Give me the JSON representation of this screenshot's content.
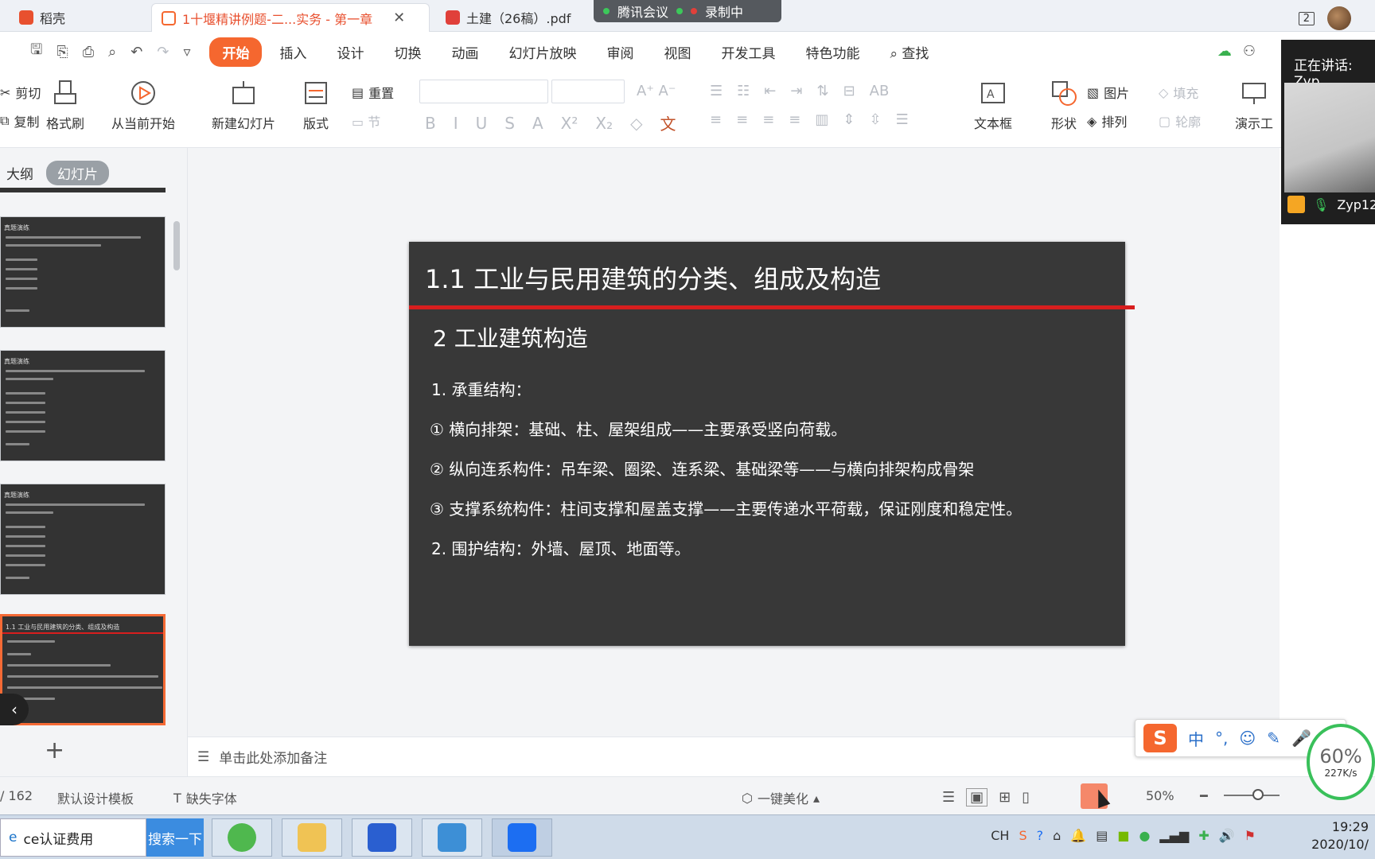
{
  "titlebar": {
    "tabs": [
      {
        "label": "稻壳",
        "color": "#e8502f"
      },
      {
        "label": "1十堰精讲例题-二...实务 - 第一章",
        "color": "#f5672f"
      },
      {
        "label": "土建（26稿）.pdf",
        "color": "#e0403a"
      }
    ],
    "meeting": {
      "name": "腾讯会议",
      "recording": "录制中"
    },
    "window_count": "2"
  },
  "menubar": {
    "items": [
      "开始",
      "插入",
      "设计",
      "切换",
      "动画",
      "幻灯片放映",
      "审阅",
      "视图",
      "开发工具",
      "特色功能"
    ],
    "search": "查找"
  },
  "ribbon": {
    "cut": "剪切",
    "copy": "复制",
    "format_painter": "格式刷",
    "play_from_current": "从当前开始",
    "new_slide": "新建幻灯片",
    "layout": "版式",
    "reset": "重置",
    "text_box": "文本框",
    "shape": "形状",
    "picture": "图片",
    "arrange": "排列",
    "fill": "填充",
    "outline": "轮廓",
    "presentation_tool": "演示工"
  },
  "left_panel": {
    "tabs": [
      "大纲",
      "幻灯片"
    ],
    "thumbnails": [
      {
        "heading": "真题演练"
      },
      {
        "heading": "真题演练"
      },
      {
        "heading": "真题演练"
      },
      {
        "heading": "1.1 工业与民用建筑的分类、组成及构造"
      }
    ]
  },
  "slide": {
    "title": "1.1 工业与民用建筑的分类、组成及构造",
    "subtitle": "2 工业建筑构造",
    "lines": [
      "1.  承重结构：",
      "①  横向排架：基础、柱、屋架组成——主要承受竖向荷载。",
      "②  纵向连系构件：吊车梁、圈梁、连系梁、基础梁等——与横向排架构成骨架",
      "③  支撑系统构件：柱间支撑和屋盖支撑——主要传递水平荷载，保证刚度和稳定性。",
      "2.  围护结构：外墙、屋顶、地面等。"
    ]
  },
  "notes": {
    "placeholder": "单击此处添加备注"
  },
  "statusbar": {
    "page": "/ 162",
    "template": "默认设计模板",
    "missing_font": "缺失字体",
    "beautify": "一键美化",
    "zoom": "50%"
  },
  "speaker": {
    "label": "正在讲话: Zyp",
    "name": "Zyp12"
  },
  "ime": {
    "mode": "中"
  },
  "netmon": {
    "percent": "60%",
    "speed": "227K/s"
  },
  "taskbar": {
    "search_value": "ce认证费用",
    "search_button": "搜索一下",
    "tray_lang": "CH",
    "time": "19:29",
    "date": "2020/10/"
  }
}
